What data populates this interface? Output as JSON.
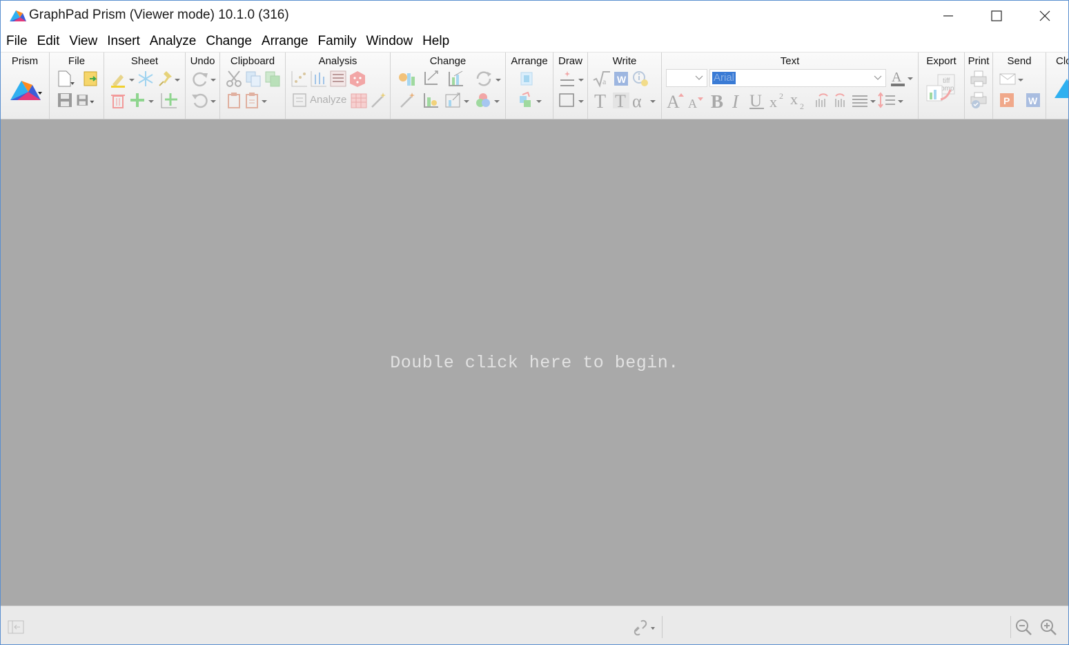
{
  "window": {
    "title": "GraphPad Prism (Viewer mode) 10.1.0 (316)"
  },
  "menu": [
    "File",
    "Edit",
    "View",
    "Insert",
    "Analyze",
    "Change",
    "Arrange",
    "Family",
    "Window",
    "Help"
  ],
  "toolbar": {
    "groups": {
      "prism": "Prism",
      "file": "File",
      "sheet": "Sheet",
      "undo": "Undo",
      "clipboard": "Clipboard",
      "analysis": "Analysis",
      "change": "Change",
      "arrange": "Arrange",
      "draw": "Draw",
      "write": "Write",
      "text": "Text",
      "export": "Export",
      "print": "Print",
      "send": "Send",
      "cloud": "Clo"
    },
    "analyze_button": "Analyze",
    "font_size": "",
    "font_name": "Arial",
    "export_icon_text_1": "tiff",
    "export_icon_text_2": "bmp"
  },
  "canvas": {
    "message": "Double click here to begin."
  },
  "colors": {
    "canvas_bg": "#a9a9a9",
    "accent": "#3a7bd5",
    "disabled_icon": "#c4c4c4"
  }
}
